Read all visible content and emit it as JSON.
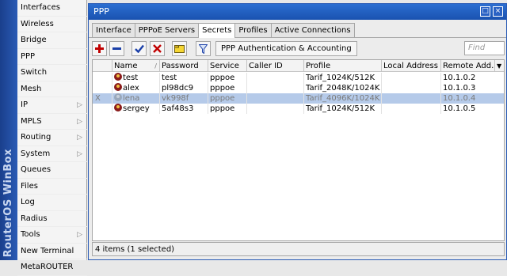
{
  "left_menu": {
    "brand_strip": "RouterOS WinBox",
    "items": [
      {
        "label": "Interfaces",
        "arrow": ""
      },
      {
        "label": "Wireless",
        "arrow": ""
      },
      {
        "label": "Bridge",
        "arrow": ""
      },
      {
        "label": "PPP",
        "arrow": ""
      },
      {
        "label": "Switch",
        "arrow": ""
      },
      {
        "label": "Mesh",
        "arrow": ""
      },
      {
        "label": "IP",
        "arrow": "▷"
      },
      {
        "label": "MPLS",
        "arrow": "▷"
      },
      {
        "label": "Routing",
        "arrow": "▷"
      },
      {
        "label": "System",
        "arrow": "▷"
      },
      {
        "label": "Queues",
        "arrow": ""
      },
      {
        "label": "Files",
        "arrow": ""
      },
      {
        "label": "Log",
        "arrow": ""
      },
      {
        "label": "Radius",
        "arrow": ""
      },
      {
        "label": "Tools",
        "arrow": "▷"
      },
      {
        "label": "New Terminal",
        "arrow": ""
      },
      {
        "label": "MetaROUTER",
        "arrow": ""
      }
    ]
  },
  "window": {
    "title": "PPP",
    "maximize_glyph": "□",
    "close_glyph": "×"
  },
  "tabs": [
    {
      "label": "Interface"
    },
    {
      "label": "PPPoE Servers"
    },
    {
      "label": "Secrets"
    },
    {
      "label": "Profiles"
    },
    {
      "label": "Active Connections"
    }
  ],
  "toolbar": {
    "add_icon": "plus-icon",
    "remove_icon": "minus-icon",
    "enable_icon": "check-icon",
    "disable_icon": "x-icon",
    "comment_icon": "note-icon",
    "filter_icon": "filter-icon",
    "auth_button_label": "PPP Authentication & Accounting",
    "find_placeholder": "Find"
  },
  "table": {
    "columns": [
      "Name",
      "Password",
      "Service",
      "Caller ID",
      "Profile",
      "Local Address",
      "Remote Add..."
    ],
    "rows": [
      {
        "flag": "",
        "name": "test",
        "password": "test",
        "service": "pppoe",
        "caller_id": "",
        "profile": "Tarif_1024K/512K",
        "local_address": "",
        "remote_address": "10.1.0.2"
      },
      {
        "flag": "",
        "name": "alex",
        "password": "pl98dc9",
        "service": "pppoe",
        "caller_id": "",
        "profile": "Tarif_2048K/1024K",
        "local_address": "",
        "remote_address": "10.1.0.3"
      },
      {
        "flag": "X",
        "name": "lena",
        "password": "vk998f",
        "service": "pppoe",
        "caller_id": "",
        "profile": "Tarif_4096K/1024K",
        "local_address": "",
        "remote_address": "10.1.0.4"
      },
      {
        "flag": "",
        "name": "sergey",
        "password": "5af48s3",
        "service": "pppoe",
        "caller_id": "",
        "profile": "Tarif_1024K/512K",
        "local_address": "",
        "remote_address": "10.1.0.5"
      }
    ]
  },
  "status_text": "4 items (1 selected)",
  "colors": {
    "title_bar": "#1a52b0",
    "selection": "#b5cae9",
    "add": "#c00000",
    "enable": "#1a3fa8"
  }
}
